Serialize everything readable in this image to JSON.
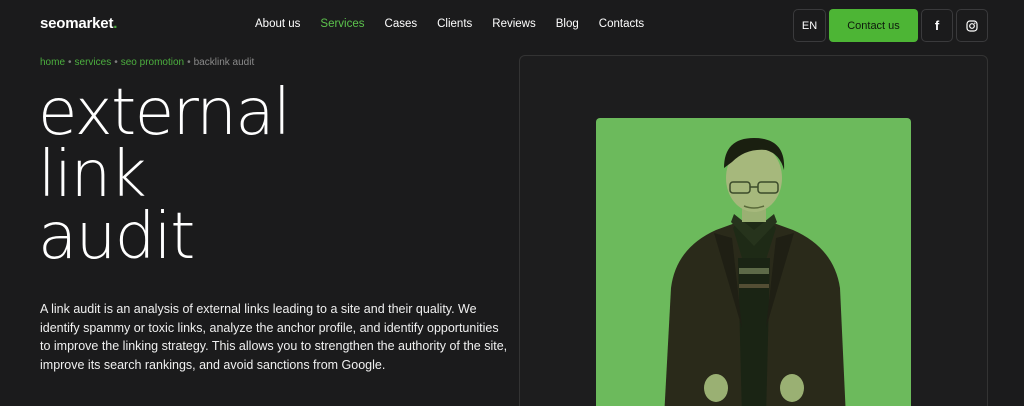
{
  "header": {
    "logo": "seomarket",
    "logo_dot": ".",
    "nav": [
      {
        "label": "About us",
        "active": false
      },
      {
        "label": "Services",
        "active": true
      },
      {
        "label": "Cases",
        "active": false
      },
      {
        "label": "Clients",
        "active": false
      },
      {
        "label": "Reviews",
        "active": false
      },
      {
        "label": "Blog",
        "active": false
      },
      {
        "label": "Contacts",
        "active": false
      }
    ],
    "lang": "EN",
    "contact_label": "Contact us",
    "facebook_glyph": "f"
  },
  "breadcrumb": {
    "items": [
      "home",
      "services",
      "seo promotion"
    ],
    "current": "backlink audit",
    "separator": "•"
  },
  "hero": {
    "title_lines": [
      "external",
      "link",
      "audit"
    ],
    "description": "A link audit is an analysis of external links leading to a site and their quality. We identify spammy or toxic links, analyze the anchor profile, and identify opportunities to improve the linking strategy. This allows you to strengthen the authority of the site, improve its search rankings, and avoid sanctions from Google."
  },
  "colors": {
    "accent": "#4db535",
    "background": "#1b1b1c",
    "photo_bg": "#6cba5c"
  },
  "icons": {
    "facebook": "facebook-icon",
    "instagram": "instagram-icon"
  }
}
